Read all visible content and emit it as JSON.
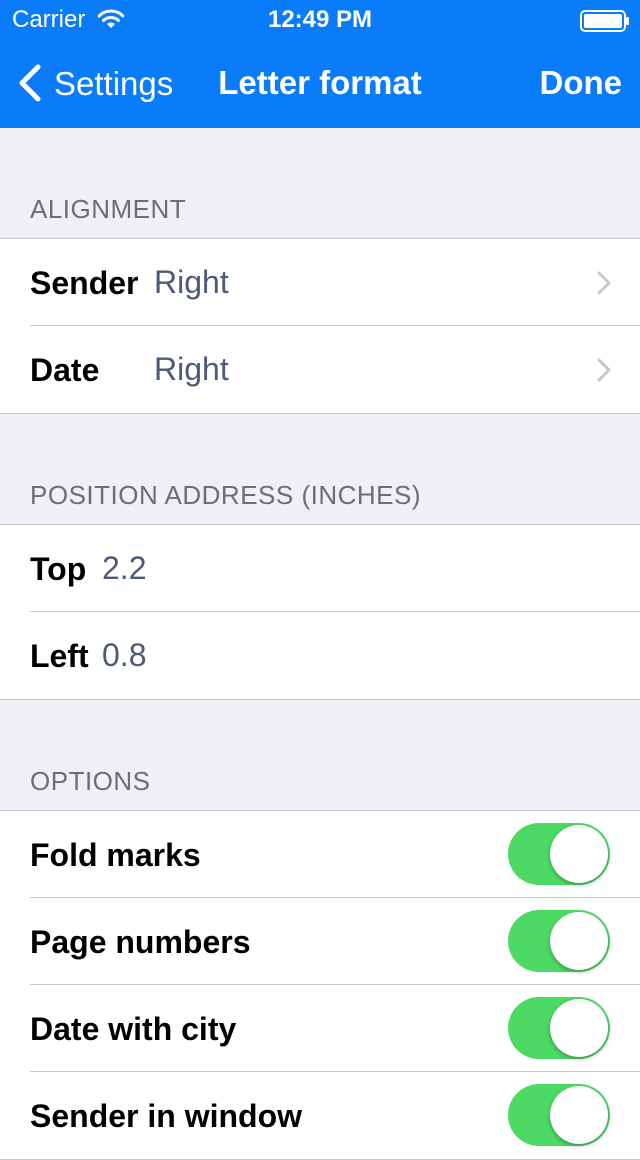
{
  "status_bar": {
    "carrier": "Carrier",
    "time": "12:49 PM",
    "wifi_icon": "wifi-icon",
    "battery_icon": "battery-icon"
  },
  "nav": {
    "back_label": "Settings",
    "title": "Letter format",
    "done_label": "Done",
    "background_color": "#0a7cfa"
  },
  "sections": {
    "alignment": {
      "header": "ALIGNMENT",
      "rows": [
        {
          "label": "Sender",
          "value": "Right"
        },
        {
          "label": "Date",
          "value": "Right"
        }
      ]
    },
    "position": {
      "header": "POSITION ADDRESS (INCHES)",
      "rows": [
        {
          "label": "Top",
          "value": "2.2"
        },
        {
          "label": "Left",
          "value": "0.8"
        }
      ]
    },
    "options": {
      "header": "OPTIONS",
      "rows": [
        {
          "label": "Fold marks",
          "on": true
        },
        {
          "label": "Page numbers",
          "on": true
        },
        {
          "label": "Date with city",
          "on": true
        },
        {
          "label": "Sender in window",
          "on": true
        }
      ]
    }
  },
  "colors": {
    "toggle_on": "#4cd964",
    "value_text": "#4a5a78",
    "grouped_background": "#efeff4"
  }
}
